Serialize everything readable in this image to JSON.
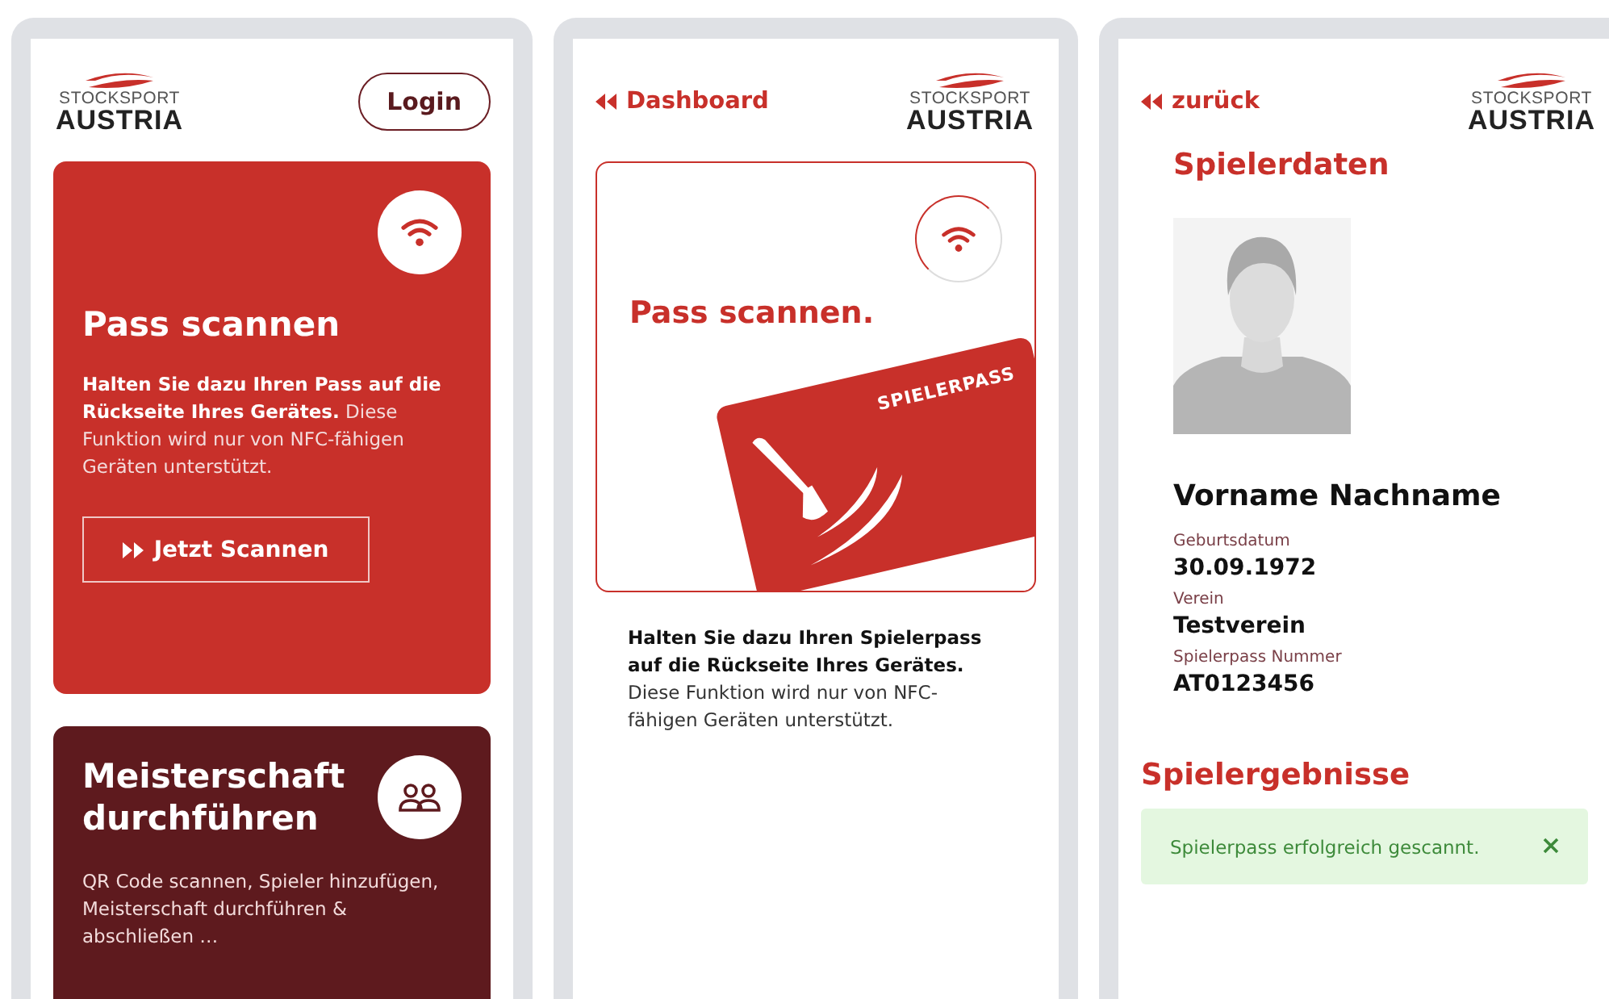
{
  "dashboard": {
    "logo": {
      "top": "STOCKSPORT",
      "bottom": "AUSTRIA"
    },
    "login": "Login",
    "cards": [
      {
        "kind": "scan",
        "title": "Pass scannen",
        "text": "**Halten Sie dazu Ihren Pass auf die Rückseite Ihres Gerätes.** Diese Funktion wird nur von NFC-fähigen Geräten unterstützt.",
        "button": "Jetzt Scannen"
      },
      {
        "kind": "championship",
        "title": "Meisterschaft durchführen",
        "text": "QR Code scannen, Spieler hinzufügen, Meisterschaft durchführen & abschließen …"
      }
    ]
  },
  "scan_page": {
    "back": "Dashboard",
    "logo": {
      "top": "STOCKSPORT",
      "bottom": "AUSTRIA"
    },
    "title": "Pass scannen.",
    "card_label": "SPIELERPASS",
    "text": "**Halten Sie dazu Ihren Spielerpass auf die Rückseite Ihres Gerätes.** Diese Funktion wird nur von NFC-fähigen Geräten unterstützt."
  },
  "player_page": {
    "back": "zurück",
    "logo": {
      "top": "STOCKSPORT",
      "bottom": "AUSTRIA"
    },
    "heading": "Spielerdaten",
    "name": "Vorname Nachname",
    "fields": [
      {
        "label": "Geburtsdatum",
        "value": "30.09.1972"
      },
      {
        "label": "Verein",
        "value": "Testverein"
      },
      {
        "label": "Spielerpass Nummer",
        "value": "AT0123456"
      }
    ],
    "results_heading": "Spielergebnisse",
    "alert": "Spielerpass erfolgreich gescannt."
  }
}
